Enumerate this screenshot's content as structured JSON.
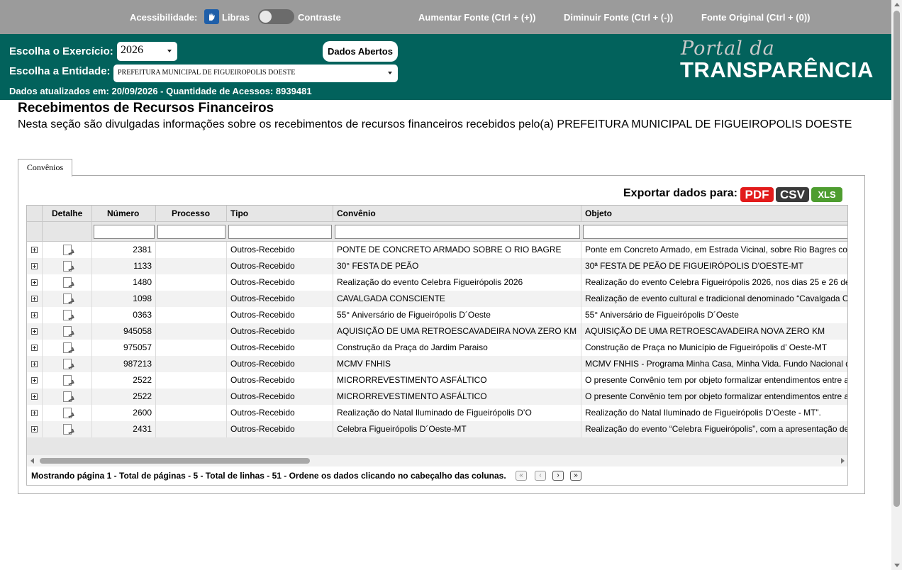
{
  "accessibility": {
    "label": "Acessibilidade:",
    "libras": "Libras",
    "contrast": "Contraste",
    "increase_font": "Aumentar Fonte (Ctrl + (+))",
    "decrease_font": "Diminuir Fonte (Ctrl + (-))",
    "original_font": "Fonte Original (Ctrl + (0))"
  },
  "header": {
    "exercise_label": "Escolha o Exercício:",
    "exercise_value": "2026",
    "entity_label": "Escolha a Entidade:",
    "entity_value": "PREFEITURA MUNICIPAL DE FIGUEIROPOLIS DOESTE",
    "open_data_button": "Dados Abertos",
    "updated_info": "Dados atualizados em: 20/09/2026 - Quantidade de Acessos: 8939481",
    "logo_top": "Portal da",
    "logo_bottom": "TRANSPARÊNCIA",
    "colors": {
      "teal": "#02625c",
      "gray_bar": "#9b9b9b"
    }
  },
  "page": {
    "title": "Recebimentos de Recursos Financeiros",
    "description": "Nesta seção são divulgadas informações sobre os recebimentos de recursos financeiros recebidos pelo(a) PREFEITURA MUNICIPAL DE FIGUEIROPOLIS DOESTE"
  },
  "tabs": [
    {
      "label": "Convênios"
    }
  ],
  "export": {
    "label": "Exportar dados para:",
    "pdf": "PDF",
    "csv": "CSV",
    "xls": "XLS"
  },
  "grid": {
    "columns": [
      "Detalhe",
      "Número",
      "Processo",
      "Tipo",
      "Convênio",
      "Objeto"
    ],
    "rows": [
      {
        "numero": "2381",
        "processo": "",
        "tipo": "Outros-Recebido",
        "convenio": "PONTE DE CONCRETO ARMADO SOBRE O RIO BAGRE",
        "objeto": "Ponte em Concreto Armado, em Estrada Vicinal, sobre Rio Bagres co"
      },
      {
        "numero": "1133",
        "processo": "",
        "tipo": "Outros-Recebido",
        "convenio": "30° FESTA DE PEÃO",
        "objeto": "30ª FESTA DE PEÃO DE FIGUEIRÓPOLIS D'OESTE-MT"
      },
      {
        "numero": "1480",
        "processo": "",
        "tipo": "Outros-Recebido",
        "convenio": "Realização do evento Celebra Figueirópolis 2026",
        "objeto": "Realização do evento Celebra Figueirópolis 2026, nos dias 25 e 26 de"
      },
      {
        "numero": "1098",
        "processo": "",
        "tipo": "Outros-Recebido",
        "convenio": "CAVALGADA CONSCIENTE",
        "objeto": "Realização de evento cultural e tradicional denominado “Cavalgada C"
      },
      {
        "numero": "0363",
        "processo": "",
        "tipo": "Outros-Recebido",
        "convenio": "55° Aniversário de Figueirópolis D´Oeste",
        "objeto": "55° Aniversário de Figueirópolis D´Oeste"
      },
      {
        "numero": "945058",
        "processo": "",
        "tipo": "Outros-Recebido",
        "convenio": "AQUISIÇÃO DE UMA RETROESCAVADEIRA NOVA ZERO KM",
        "objeto": "AQUISIÇÃO DE UMA RETROESCAVADEIRA NOVA ZERO KM"
      },
      {
        "numero": "975057",
        "processo": "",
        "tipo": "Outros-Recebido",
        "convenio": "Construção da Praça do Jardim Paraiso",
        "objeto": "Construção de Praça no Município de Figueirópolis d’ Oeste-MT"
      },
      {
        "numero": "987213",
        "processo": "",
        "tipo": "Outros-Recebido",
        "convenio": "MCMV FNHIS",
        "objeto": "MCMV FNHIS - Programa Minha Casa, Minha Vida. Fundo Nacional d"
      },
      {
        "numero": "2522",
        "processo": "",
        "tipo": "Outros-Recebido",
        "convenio": "MICRORREVESTIMENTO ASFÁLTICO",
        "objeto": "O presente Convênio tem por objeto formalizar entendimentos entre a"
      },
      {
        "numero": "2522",
        "processo": "",
        "tipo": "Outros-Recebido",
        "convenio": "MICRORREVESTIMENTO ASFÁLTICO",
        "objeto": "O presente Convênio tem por objeto formalizar entendimentos entre a"
      },
      {
        "numero": "2600",
        "processo": "",
        "tipo": "Outros-Recebido",
        "convenio": "Realização do Natal Iluminado de Figueirópolis D’O",
        "objeto": "Realização do Natal Iluminado de Figueirópolis D’Oeste - MT”."
      },
      {
        "numero": "2431",
        "processo": "",
        "tipo": "Outros-Recebido",
        "convenio": "Celebra Figueirópolis D´Oeste-MT",
        "objeto": "Realização do evento “Celebra Figueirópolis”, com a apresentação de"
      }
    ],
    "pager_text": "Mostrando página 1 - Total de páginas - 5 - Total de linhas - 51 - Ordene os dados clicando no cabeçalho das colunas.",
    "pager_buttons": {
      "first": "«",
      "prev": "‹",
      "next": "›",
      "last": "»"
    }
  }
}
